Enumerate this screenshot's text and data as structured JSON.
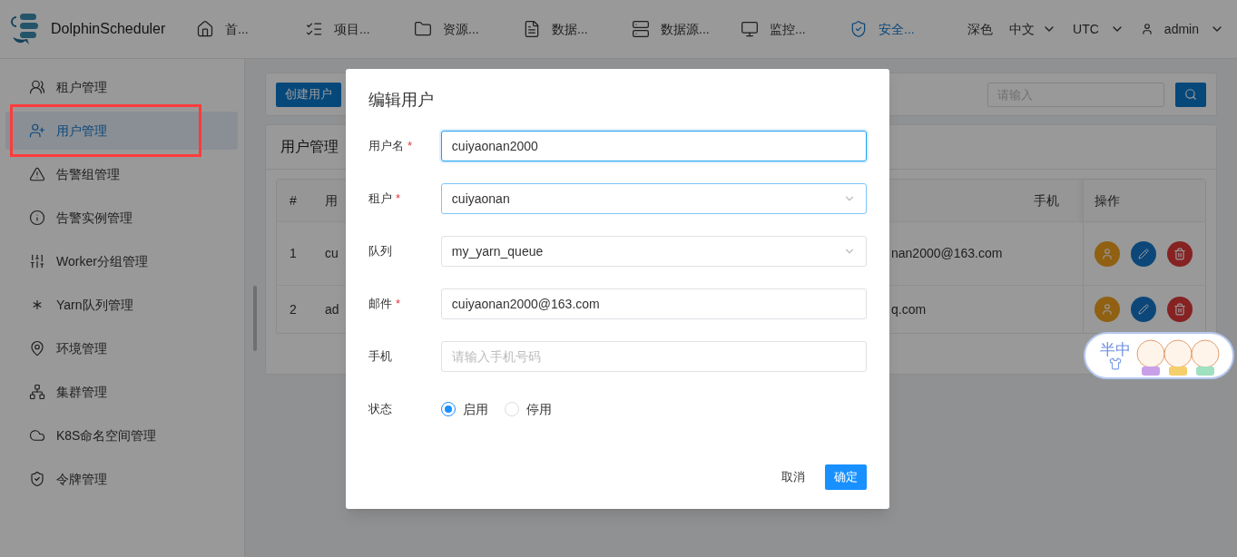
{
  "logo": {
    "text": "DolphinScheduler"
  },
  "nav": [
    {
      "label": "首...",
      "selected": false
    },
    {
      "label": "项目...",
      "selected": false
    },
    {
      "label": "资源...",
      "selected": false
    },
    {
      "label": "数据...",
      "selected": false
    },
    {
      "label": "数据源...",
      "selected": false
    },
    {
      "label": "监控...",
      "selected": false
    },
    {
      "label": "安全...",
      "selected": true
    }
  ],
  "header_right": {
    "theme": "深色",
    "language": "中文",
    "timezone": "UTC",
    "user": "admin"
  },
  "sidebar": {
    "items": [
      {
        "label": "租户管理",
        "selected": false,
        "annotated": false
      },
      {
        "label": "用户管理",
        "selected": true,
        "annotated": true
      },
      {
        "label": "告警组管理",
        "selected": false,
        "annotated": false
      },
      {
        "label": "告警实例管理",
        "selected": false,
        "annotated": false
      },
      {
        "label": "Worker分组管理",
        "selected": false,
        "annotated": false
      },
      {
        "label": "Yarn队列管理",
        "selected": false,
        "annotated": false
      },
      {
        "label": "环境管理",
        "selected": false,
        "annotated": false
      },
      {
        "label": "集群管理",
        "selected": false,
        "annotated": false
      },
      {
        "label": "K8S命名空间管理",
        "selected": false,
        "annotated": false
      },
      {
        "label": "令牌管理",
        "selected": false,
        "annotated": false
      }
    ]
  },
  "toolbar": {
    "create_button": "创建用户",
    "search": {
      "placeholder": "请输入"
    }
  },
  "table_card": {
    "title": "用户管理",
    "columns": [
      "#",
      "用",
      "手机",
      "操作"
    ],
    "rows": [
      {
        "cells": [
          "1",
          "cu",
          "nan2000@163.com"
        ]
      },
      {
        "cells": [
          "2",
          "ad",
          "q.com"
        ]
      }
    ]
  },
  "dialog": {
    "title": "编辑用户",
    "fields": [
      {
        "label": "用户名",
        "required_mark": "*",
        "kind": "input",
        "value": "cuiyaonan2000",
        "focused": true
      },
      {
        "label": "租户",
        "required_mark": "*",
        "kind": "select",
        "value": "cuiyaonan",
        "focused": true
      },
      {
        "label": "队列",
        "kind": "select",
        "value": "my_yarn_queue",
        "focused": false
      },
      {
        "label": "邮件",
        "required_mark": "*",
        "kind": "input",
        "value": "cuiyaonan2000@163.com",
        "focused": false
      },
      {
        "label": "手机",
        "kind": "input",
        "placeholder": "请输入手机号码",
        "focused": false
      }
    ],
    "status": {
      "label": "状态",
      "options": [
        {
          "label": "启用",
          "selected": true
        },
        {
          "label": "停用",
          "selected": false
        }
      ]
    },
    "buttons": {
      "cancel": "取消",
      "confirm": "确定"
    }
  },
  "ime_toolbar": {
    "text": "半中"
  }
}
